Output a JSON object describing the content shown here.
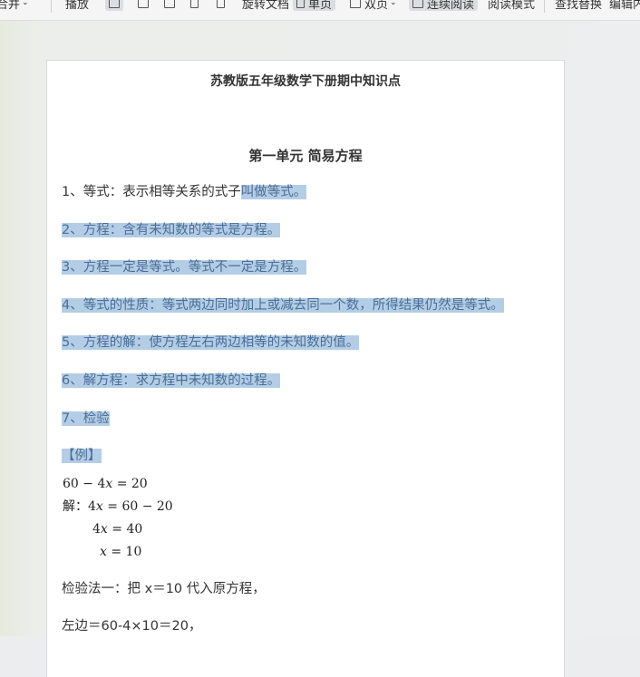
{
  "toolbar": {
    "merge_label": "合并",
    "play_label": "播放",
    "rotate_doc_label": "旋转文档",
    "single_page_label": "单页",
    "double_page_label": "双页",
    "continuous_read_label": "连续阅读",
    "read_mode_label": "阅读模式",
    "find_replace_label": "查找替换",
    "edit_label": "编辑内"
  },
  "document": {
    "title": "苏教版五年级数学下册期中知识点",
    "unit_title": "第一单元 简易方程",
    "items": {
      "i1_plain": "1、等式：表示相等关系的式子",
      "i1_sel": "叫做等式。",
      "i2": "2、方程：含有未知数的等式是方程。",
      "i3": "3、方程一定是等式。等式不一定是方程。",
      "i4": "4、等式的性质：等式两边同时加上或减去同一个数，所得结果仍然是等式。",
      "i5": "5、方程的解：使方程左右两边相等的未知数的值。",
      "i6": "6、解方程：求方程中未知数的过程。",
      "i7": "7、检验"
    },
    "example_label": "【例】",
    "equation": {
      "line1_a": "60 − 4",
      "line1_v": "x",
      "line1_b": " = 20",
      "solve_label": "解：",
      "line2_a": "4",
      "line2_v": "x",
      "line2_b": " = 60 − 20",
      "line3_a": "4",
      "line3_v": "x",
      "line3_b": " = 40",
      "line4_v": "x",
      "line4_b": " = 10"
    },
    "check_method1": "检验法一：把 x＝10 代入原方程，",
    "left_side": "左边＝60-4×10＝20，"
  }
}
